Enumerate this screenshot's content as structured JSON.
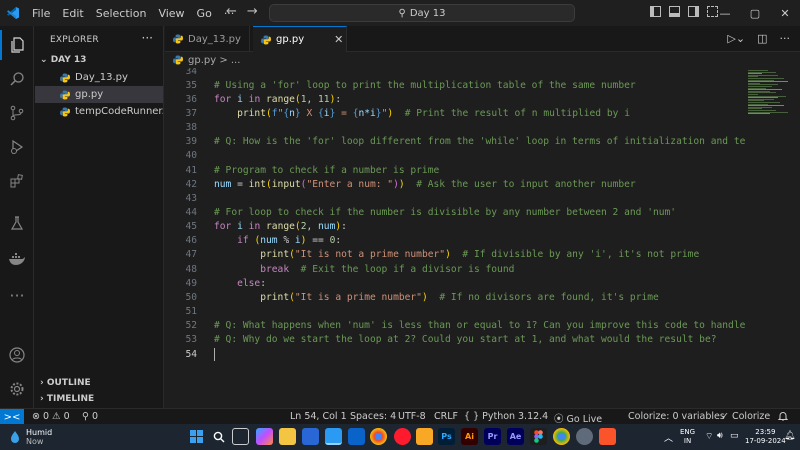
{
  "titlebar": {
    "menu": [
      "File",
      "Edit",
      "Selection",
      "View",
      "Go",
      "···"
    ],
    "search_text": "Day 13",
    "nav_back": "←",
    "nav_forward": "→"
  },
  "sidebar": {
    "header": "EXPLORER",
    "more": "···",
    "folder": "DAY 13",
    "files": [
      "Day_13.py",
      "gp.py",
      "tempCodeRunner..."
    ],
    "selected_file": "gp.py",
    "outline": "OUTLINE",
    "timeline": "TIMELINE"
  },
  "tabs": [
    {
      "label": "Day_13.py",
      "active": false
    },
    {
      "label": "gp.py",
      "active": true
    }
  ],
  "breadcrumb": "gp.py > ...",
  "editor": {
    "current_line": 54,
    "lines": [
      {
        "num": "34",
        "text": ""
      },
      {
        "num": "35",
        "text": "# Using a 'for' loop to print the multiplication table of the same number"
      },
      {
        "num": "36",
        "text": "for i in range(1, 11):"
      },
      {
        "num": "37",
        "text": "    print(f\"{n} X {i} = {n*i}\")  # Print the result of n multiplied by i"
      },
      {
        "num": "38",
        "text": ""
      },
      {
        "num": "39",
        "text": "# Q: How is the 'for' loop different from the 'while' loop in terms of initialization and te"
      },
      {
        "num": "40",
        "text": ""
      },
      {
        "num": "41",
        "text": "# Program to check if a number is prime"
      },
      {
        "num": "42",
        "text": "num = int(input(\"Enter a num: \"))  # Ask the user to input another number"
      },
      {
        "num": "43",
        "text": ""
      },
      {
        "num": "44",
        "text": "# For loop to check if the number is divisible by any number between 2 and 'num'"
      },
      {
        "num": "45",
        "text": "for i in range(2, num):"
      },
      {
        "num": "46",
        "text": "    if (num % i) == 0:"
      },
      {
        "num": "47",
        "text": "        print(\"It is not a prime number\")  # If divisible by any 'i', it's not prime"
      },
      {
        "num": "48",
        "text": "        break  # Exit the loop if a divisor is found"
      },
      {
        "num": "49",
        "text": "    else:"
      },
      {
        "num": "50",
        "text": "        print(\"It is a prime number\")  # If no divisors are found, it's prime"
      },
      {
        "num": "51",
        "text": ""
      },
      {
        "num": "52",
        "text": "# Q: What happens when 'num' is less than or equal to 1? Can you improve this code to handle"
      },
      {
        "num": "53",
        "text": "# Q: Why do we start the loop at 2? Could you start at 1, and what would the result be?"
      },
      {
        "num": "54",
        "text": ""
      }
    ]
  },
  "status": {
    "remote": "><",
    "problems": "⊗ 0 ⚠ 0",
    "ports": "⚲ 0",
    "position": "Ln 54, Col 1",
    "spaces": "Spaces: 4",
    "encoding": "UTF-8",
    "eol": "CRLF",
    "language": "{ }  Python",
    "version": "3.12.4",
    "golive": "⦿ Go Live",
    "colorize_vars": "Colorize: 0 variables",
    "colorize": "✓ Colorize",
    "bell": "🔔"
  },
  "taskbar": {
    "weather_title": "Humid",
    "weather_sub": "Now",
    "lang_top": "ENG",
    "lang_bottom": "IN",
    "time": "23:59",
    "date": "17-09-2024",
    "colors": {
      "bg": "#1c2530",
      "accent": "#0078d4"
    }
  }
}
